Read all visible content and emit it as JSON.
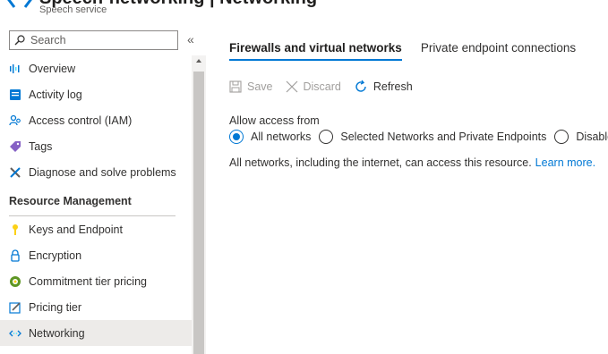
{
  "header": {
    "title": "Speech-networking | Networking",
    "subtitle": "Speech service"
  },
  "sidebar": {
    "search": {
      "placeholder": "Search"
    },
    "collapse_glyph": "«",
    "items_top": [
      {
        "label": "Overview",
        "icon": "overview-icon"
      },
      {
        "label": "Activity log",
        "icon": "activity-log-icon"
      },
      {
        "label": "Access control (IAM)",
        "icon": "access-control-icon"
      },
      {
        "label": "Tags",
        "icon": "tag-icon"
      },
      {
        "label": "Diagnose and solve problems",
        "icon": "wrench-icon"
      }
    ],
    "section": "Resource Management",
    "items_resource": [
      {
        "label": "Keys and Endpoint",
        "icon": "key-icon"
      },
      {
        "label": "Encryption",
        "icon": "lock-icon"
      },
      {
        "label": "Commitment tier pricing",
        "icon": "commitment-icon"
      },
      {
        "label": "Pricing tier",
        "icon": "pricing-tier-icon"
      },
      {
        "label": "Networking",
        "icon": "networking-icon",
        "active": true
      }
    ]
  },
  "main": {
    "tabs": [
      {
        "label": "Firewalls and virtual networks",
        "active": true
      },
      {
        "label": "Private endpoint connections"
      }
    ],
    "toolbar": {
      "save": "Save",
      "discard": "Discard",
      "refresh": "Refresh"
    },
    "access": {
      "label": "Allow access from",
      "options": [
        {
          "label": "All networks",
          "checked": true
        },
        {
          "label": "Selected Networks and Private Endpoints"
        },
        {
          "label": "Disabled"
        }
      ],
      "info": "All networks, including the internet, can access this resource.",
      "learn_more": "Learn more."
    }
  },
  "colors": {
    "accent": "#0078d4",
    "active_nav": "#edebe9",
    "text": "#323130",
    "disabled": "#a19f9d"
  }
}
